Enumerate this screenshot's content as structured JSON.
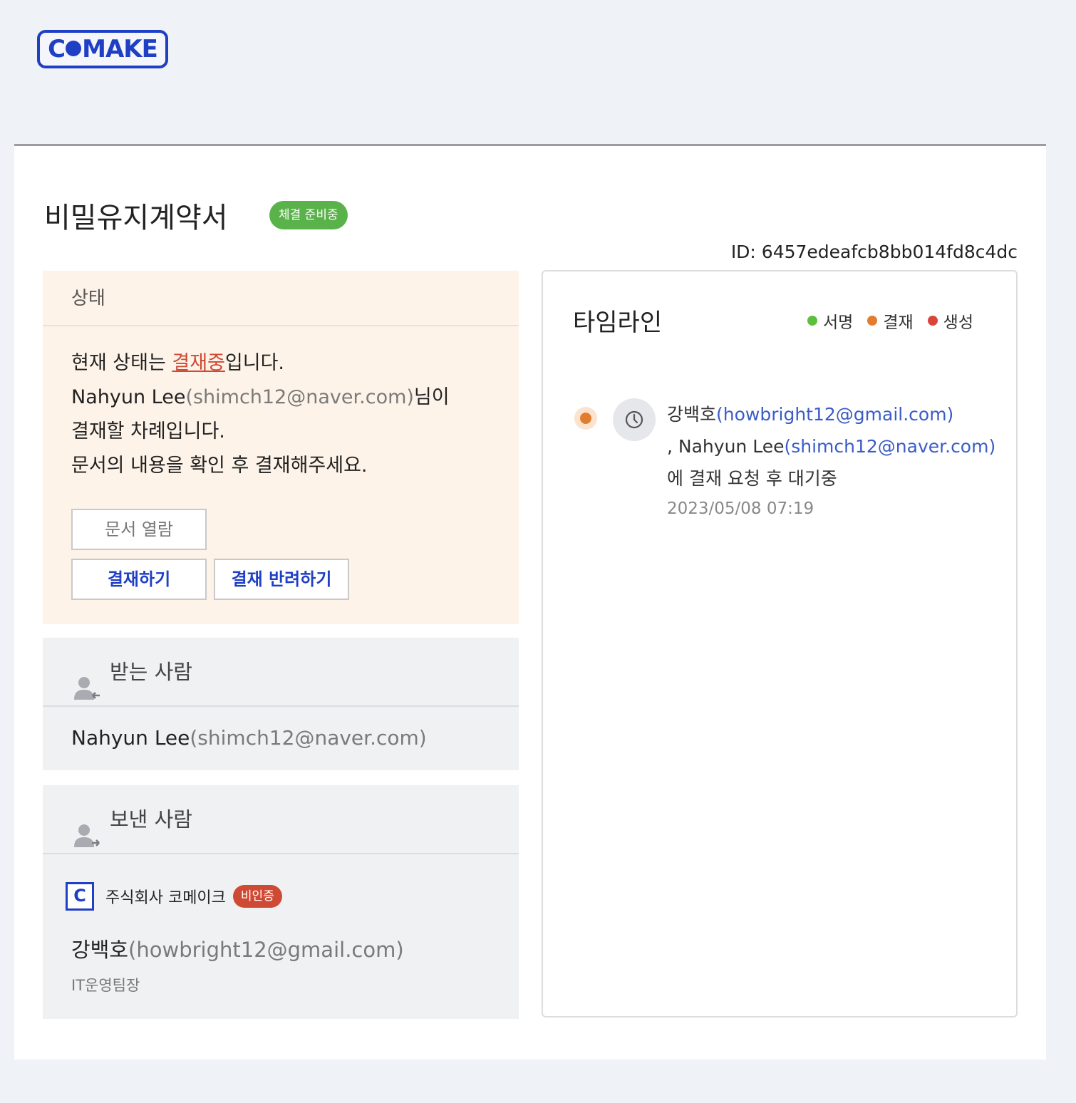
{
  "logo": {
    "text_left": "C",
    "text_right": "MAKE"
  },
  "document": {
    "title": "비밀유지계약서",
    "badge": "체결 준비중",
    "id_label": "ID: 6457edeafcb8bb014fd8c4dc"
  },
  "status": {
    "heading": "상태",
    "line1_prefix": "현재 상태는 ",
    "line1_link": "결재중",
    "line1_suffix": "입니다.",
    "line2_name": "Nahyun Lee",
    "line2_email": "(shimch12@naver.com)",
    "line2_suffix": "님이",
    "line3": "결재할 차례입니다.",
    "line4": "문서의 내용을 확인 후 결재해주세요.",
    "view_button": "문서 열람",
    "approve_button": "결재하기",
    "reject_button": "결재 반려하기"
  },
  "recipient": {
    "heading": "받는 사람",
    "name": "Nahyun Lee",
    "email": "(shimch12@naver.com)"
  },
  "sender": {
    "heading": "보낸 사람",
    "company_logo": "C",
    "company_name": "주식회사 코메이크",
    "company_badge": "비인증",
    "name": "강백호",
    "email": "(howbright12@gmail.com)",
    "role": "IT운영팀장"
  },
  "timeline": {
    "title": "타임라인",
    "legend": [
      {
        "label": "서명",
        "color": "#5cbf3e"
      },
      {
        "label": "결재",
        "color": "#e27d30"
      },
      {
        "label": "생성",
        "color": "#d9453a"
      }
    ],
    "entry": {
      "name1": "강백호",
      "email1": "(howbright12@gmail.com)",
      "sep": ", ",
      "name2": "Nahyun Lee",
      "email2": "(shimch12@naver.com)",
      "action": "에 결재 요청 후 대기중",
      "date": "2023/05/08 07:19"
    }
  }
}
